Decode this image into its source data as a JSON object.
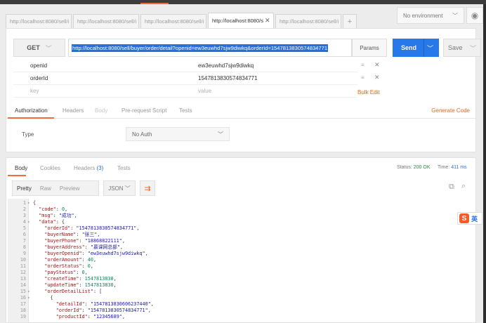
{
  "tabs": [
    {
      "label": "http://localhost:8080/sell/i"
    },
    {
      "label": "http://localhost:8080/sell/i"
    },
    {
      "label": "http://localhost:8080/sell/i"
    },
    {
      "label": "http://localhost:8080/s",
      "active": true
    },
    {
      "label": "http://localhost:8080/sell/i"
    }
  ],
  "tab_close": "✕",
  "tab_add": "+",
  "environment": {
    "selected": "No environment"
  },
  "request": {
    "method": "GET",
    "url": "http://localhost:8080/sell/buyer/order/detail?openid=ew3euwhd7sjw9diwkq&orderId=1547813830574834771",
    "params_label": "Params",
    "send_label": "Send",
    "save_label": "Save"
  },
  "params": [
    {
      "key": "openid",
      "value": "ew3euwhd7sjw9diwkq"
    },
    {
      "key": "orderId",
      "value": "1547813830574834771"
    }
  ],
  "params_placeholder": {
    "key": "key",
    "value": "value"
  },
  "bulk_edit": "Bulk Edit",
  "request_tabs": [
    "Authorization",
    "Headers",
    "Body",
    "Pre-request Script",
    "Tests"
  ],
  "generate_code": "Generate Code",
  "auth": {
    "type_label": "Type",
    "type_value": "No Auth"
  },
  "response_tabs": {
    "body": "Body",
    "cookies": "Cookies",
    "headers": "Headers",
    "headers_count": "(3)",
    "tests": "Tests"
  },
  "status": {
    "label": "Status:",
    "value": "200 OK",
    "time_label": "Time:",
    "time_value": "411 ms"
  },
  "view_modes": [
    "Pretty",
    "Raw",
    "Preview"
  ],
  "format": "JSON",
  "ime": {
    "text": "英"
  },
  "code_lines": [
    {
      "n": "1",
      "fold": "▾",
      "html": "{"
    },
    {
      "n": "2",
      "fold": "",
      "html": "  <span class='key'>\"code\"</span>: <span class='num'>0</span>,"
    },
    {
      "n": "3",
      "fold": "",
      "html": "  <span class='key'>\"msg\"</span>: <span class='str'>\"成功\"</span>,"
    },
    {
      "n": "4",
      "fold": "▾",
      "html": "  <span class='key'>\"data\"</span>: {"
    },
    {
      "n": "5",
      "fold": "",
      "html": "    <span class='key'>\"orderId\"</span>: <span class='str'>\"1547813830574834771\"</span>,"
    },
    {
      "n": "6",
      "fold": "",
      "html": "    <span class='key'>\"buyerName\"</span>: <span class='str'>\"张三\"</span>,"
    },
    {
      "n": "7",
      "fold": "",
      "html": "    <span class='key'>\"buyerPhone\"</span>: <span class='str'>\"18868822111\"</span>,"
    },
    {
      "n": "8",
      "fold": "",
      "html": "    <span class='key'>\"buyerAddress\"</span>: <span class='str'>\"慕课网总部\"</span>,"
    },
    {
      "n": "9",
      "fold": "",
      "html": "    <span class='key'>\"buyerOpenid\"</span>: <span class='str'>\"ew3euwhd7sjw9diwkq\"</span>,"
    },
    {
      "n": "10",
      "fold": "",
      "html": "    <span class='key'>\"orderAmount\"</span>: <span class='num'>40</span>,"
    },
    {
      "n": "11",
      "fold": "",
      "html": "    <span class='key'>\"orderStatus\"</span>: <span class='num'>0</span>,"
    },
    {
      "n": "12",
      "fold": "",
      "html": "    <span class='key'>\"payStatus\"</span>: <span class='num'>0</span>,"
    },
    {
      "n": "13",
      "fold": "",
      "html": "    <span class='key'>\"createTime\"</span>: <span class='num'>1547813830</span>,"
    },
    {
      "n": "14",
      "fold": "",
      "html": "    <span class='key'>\"updateTime\"</span>: <span class='num'>1547813830</span>,"
    },
    {
      "n": "15",
      "fold": "▾",
      "html": "    <span class='key'>\"orderDetailList\"</span>: ["
    },
    {
      "n": "16",
      "fold": "▾",
      "html": "      {"
    },
    {
      "n": "17",
      "fold": "",
      "html": "        <span class='key'>\"detailId\"</span>: <span class='str'>\"1547813830606237440\"</span>,"
    },
    {
      "n": "18",
      "fold": "",
      "html": "        <span class='key'>\"orderId\"</span>: <span class='str'>\"1547813830574834771\"</span>,"
    },
    {
      "n": "19",
      "fold": "",
      "html": "        <span class='key'>\"productId\"</span>: <span class='str'>\"12345689\"</span>,"
    }
  ]
}
